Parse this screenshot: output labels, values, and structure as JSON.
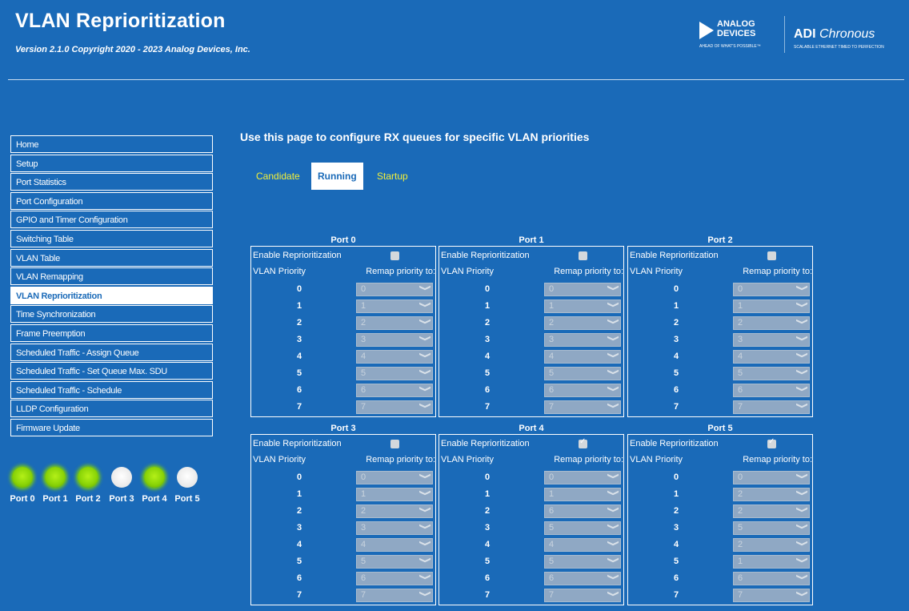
{
  "header": {
    "title": "VLAN Reprioritization",
    "version": "Version 2.1.0 Copyright 2020 - 2023 Analog Devices, Inc.",
    "adi_logo_line1": "ANALOG",
    "adi_logo_line2": "DEVICES",
    "adi_tagline": "AHEAD OF WHAT'S POSSIBLE™",
    "chronous_name_bold": "ADI",
    "chronous_name_italic": "Chronous",
    "chronous_tagline": "SCALABLE ETHERNET TIMED TO PERFECTION"
  },
  "sidebar": {
    "items": [
      {
        "label": "Home"
      },
      {
        "label": "Setup"
      },
      {
        "label": "Port Statistics"
      },
      {
        "label": "Port Configuration"
      },
      {
        "label": "GPIO and Timer Configuration"
      },
      {
        "label": "Switching Table"
      },
      {
        "label": "VLAN Table"
      },
      {
        "label": "VLAN Remapping"
      },
      {
        "label": "VLAN Reprioritization",
        "active": true
      },
      {
        "label": "Time Synchronization"
      },
      {
        "label": "Frame Preemption"
      },
      {
        "label": "Scheduled Traffic - Assign Queue"
      },
      {
        "label": "Scheduled Traffic - Set Queue Max. SDU"
      },
      {
        "label": "Scheduled Traffic - Schedule"
      },
      {
        "label": "LLDP Configuration"
      },
      {
        "label": "Firmware Update"
      }
    ]
  },
  "leds": [
    {
      "label": "Port 0",
      "state": "on"
    },
    {
      "label": "Port 1",
      "state": "on"
    },
    {
      "label": "Port 2",
      "state": "on"
    },
    {
      "label": "Port 3",
      "state": "off"
    },
    {
      "label": "Port 4",
      "state": "on"
    },
    {
      "label": "Port 5",
      "state": "off"
    }
  ],
  "main": {
    "intro": "Use this page to configure RX queues for specific VLAN priorities",
    "tabs": [
      {
        "label": "Candidate",
        "active": false
      },
      {
        "label": "Running",
        "active": true
      },
      {
        "label": "Startup",
        "active": false
      }
    ],
    "enable_label": "Enable Reprioritization",
    "col_priority": "VLAN Priority",
    "col_remap": "Remap priority to:",
    "ports": [
      {
        "title": "Port 0",
        "enabled": false,
        "map": [
          "0",
          "1",
          "2",
          "3",
          "4",
          "5",
          "6",
          "7"
        ]
      },
      {
        "title": "Port 1",
        "enabled": false,
        "map": [
          "0",
          "1",
          "2",
          "3",
          "4",
          "5",
          "6",
          "7"
        ]
      },
      {
        "title": "Port 2",
        "enabled": false,
        "map": [
          "0",
          "1",
          "2",
          "3",
          "4",
          "5",
          "6",
          "7"
        ]
      },
      {
        "title": "Port 3",
        "enabled": false,
        "map": [
          "0",
          "1",
          "2",
          "3",
          "4",
          "5",
          "6",
          "7"
        ]
      },
      {
        "title": "Port 4",
        "enabled": true,
        "map": [
          "0",
          "1",
          "6",
          "5",
          "4",
          "5",
          "6",
          "7"
        ]
      },
      {
        "title": "Port 5",
        "enabled": true,
        "map": [
          "0",
          "2",
          "2",
          "5",
          "2",
          "1",
          "6",
          "7"
        ]
      }
    ]
  },
  "colors": {
    "background": "#1a6ab8",
    "link_yellow": "#f2ef3a",
    "led_on": "#8ad407",
    "led_off": "#e8e8e8"
  }
}
